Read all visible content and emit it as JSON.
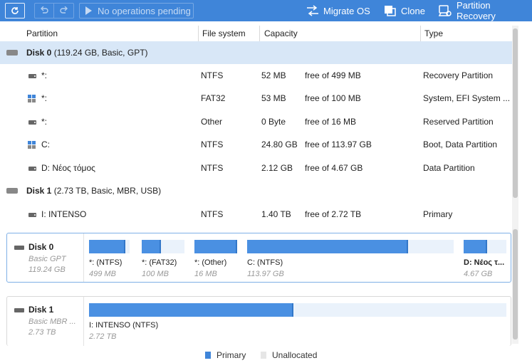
{
  "toolbar": {
    "pending_label": "No operations pending",
    "migrate_label": "Migrate OS",
    "clone_label": "Clone",
    "recovery_label": "Partition Recovery",
    "icons": [
      "refresh-icon",
      "undo-icon",
      "redo-icon",
      "play-icon",
      "migrate-icon",
      "clone-icon",
      "recovery-icon"
    ]
  },
  "table": {
    "headers": {
      "partition": "Partition",
      "filesystem": "File system",
      "capacity": "Capacity",
      "type": "Type"
    },
    "disk0": {
      "name": "Disk 0",
      "details": " (119.24 GB, Basic, GPT)"
    },
    "disk1": {
      "name": "Disk 1",
      "details": " (2.73 TB, Basic, MBR, USB)"
    },
    "rows": [
      {
        "name": "*:",
        "fs": "NTFS",
        "used": "52 MB",
        "free": "free of 499 MB",
        "type": "Recovery Partition"
      },
      {
        "name": "*:",
        "fs": "FAT32",
        "used": "53 MB",
        "free": "free of 100 MB",
        "type": "System, EFI System ..."
      },
      {
        "name": "*:",
        "fs": "Other",
        "used": "0 Byte",
        "free": "free of 16 MB",
        "type": "Reserved Partition"
      },
      {
        "name": "C:",
        "fs": "NTFS",
        "used": "24.80 GB",
        "free": "free of 113.97 GB",
        "type": "Boot, Data Partition"
      },
      {
        "name": "D: Νέος τόμος",
        "fs": "NTFS",
        "used": "2.12 GB",
        "free": "free of 4.67 GB",
        "type": "Data Partition"
      },
      {
        "name": "I: INTENSO",
        "fs": "NTFS",
        "used": "1.40 TB",
        "free": "free of 2.72 TB",
        "type": "Primary"
      }
    ]
  },
  "map": {
    "disk0": {
      "name": "Disk 0",
      "style": "Basic GPT",
      "size": "119.24 GB",
      "segments": [
        {
          "label": "*: (NTFS)",
          "size": "499 MB",
          "fill": 0.9
        },
        {
          "label": "*: (FAT32)",
          "size": "100 MB",
          "fill": 0.45
        },
        {
          "label": "*: (Other)",
          "size": "16 MB",
          "fill": 1.0
        },
        {
          "label": "C: (NTFS)",
          "size": "113.97 GB",
          "fill": 0.78
        },
        {
          "label": "D: Νέος τ...",
          "size": "4.67 GB",
          "fill": 0.55
        }
      ]
    },
    "disk1": {
      "name": "Disk 1",
      "style": "Basic MBR ...",
      "size": "2.73 TB",
      "segments": [
        {
          "label": "I: INTENSO (NTFS)",
          "size": "2.72 TB",
          "fill": 0.49
        }
      ]
    }
  },
  "legend": {
    "primary": "Primary",
    "unallocated": "Unallocated"
  },
  "colors": {
    "accent": "#3f85d9",
    "selected_row": "#d8e7f7",
    "bar_fill": "#4a90e2",
    "bar_free": "#eaf2fb"
  }
}
